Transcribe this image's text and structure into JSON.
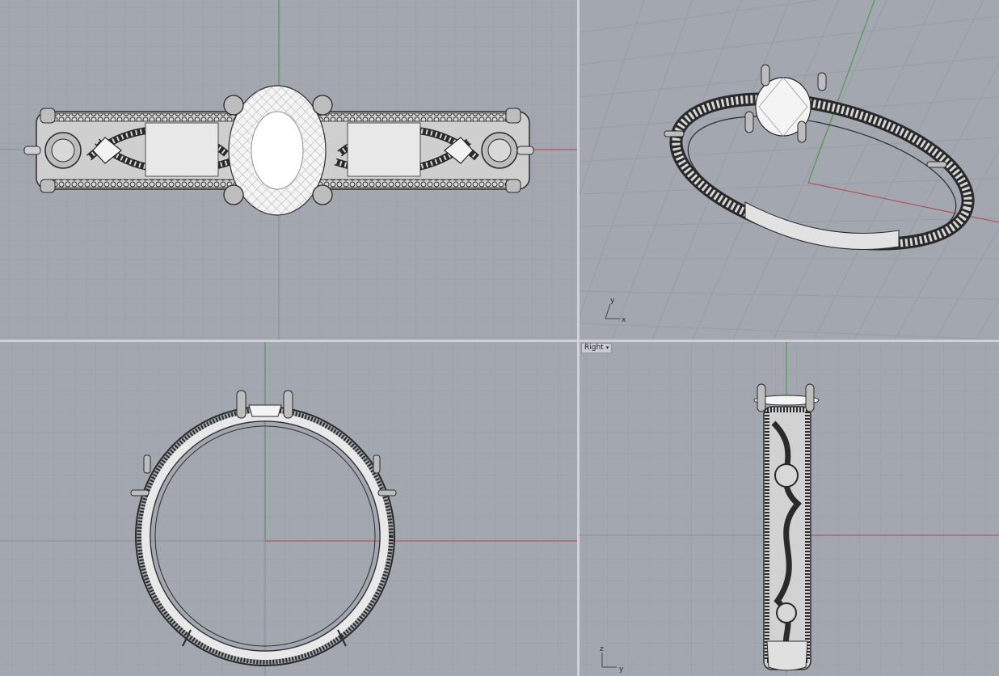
{
  "viewports": [
    {
      "name": "top",
      "label": ""
    },
    {
      "name": "perspective",
      "label": ""
    },
    {
      "name": "front",
      "label": ""
    },
    {
      "name": "right",
      "label": "Right"
    }
  ],
  "axis_labels": {
    "perspective": {
      "x": "x",
      "y": "y"
    },
    "right": {
      "y": "y",
      "z": "z"
    }
  },
  "colors": {
    "viewport_bg": "#a3a8b0",
    "grid_minor": "#999ea6",
    "grid_major": "#8d929a",
    "x_axis": "#b04848",
    "y_axis": "#3a9a3a",
    "wire": "#2a2a2a",
    "gem": "#f4f4f4"
  },
  "icons": {
    "viewport_menu": "chevron-down-icon"
  }
}
